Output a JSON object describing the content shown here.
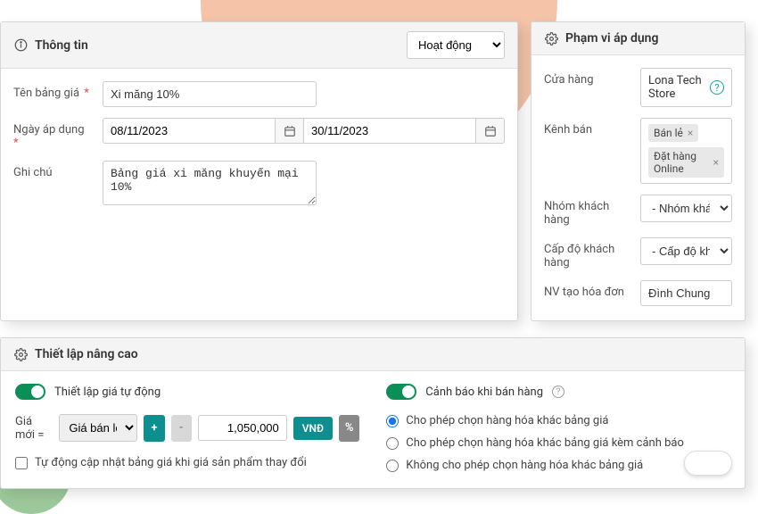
{
  "leftPanel": {
    "title": "Thông tin",
    "status_options": [
      "Hoạt động"
    ],
    "status_value": "Hoạt động",
    "fields": {
      "name_label": "Tên bảng giá",
      "name_value": "Xi măng 10%",
      "date_label": "Ngày áp dụng",
      "date_from": "08/11/2023",
      "date_to": "30/11/2023",
      "note_label": "Ghi chú",
      "note_value": "Bảng giá xi măng khuyến mại 10%"
    }
  },
  "rightPanel": {
    "title": "Phạm vi áp dụng",
    "store_label": "Cửa hàng",
    "store_value": "Lona Tech Store",
    "channel_label": "Kênh bán",
    "channel_chips": [
      "Bán lẻ",
      "Đặt hàng Online"
    ],
    "cust_group_label": "Nhóm khách hàng",
    "cust_group_placeholder": "- Nhóm khách hàng -",
    "cust_level_label": "Cấp độ khách hàng",
    "cust_level_placeholder": "- Cấp độ khách hàng -",
    "creator_label": "NV tạo hóa đơn",
    "creator_value": "Đình Chung"
  },
  "advanced": {
    "header": "Thiết lập nâng cao",
    "auto_price_label": "Thiết lập giá tự động",
    "new_price_label": "Giá mới =",
    "basis_option": "Giá bán lẻ",
    "plus": "+",
    "minus": "-",
    "amount": "1,050,000",
    "vnd": "VNĐ",
    "percent": "%",
    "auto_update_label": "Tự động cập nhật bảng giá khi giá sản phẩm thay đổi",
    "warn_label": "Cảnh báo khi bán hàng",
    "radio1": "Cho phép chọn hàng hóa khác bảng giá",
    "radio2": "Cho phép chọn hàng hóa khác bảng giá kèm cảnh báo",
    "radio3": "Không cho phép chọn hàng hóa khác bảng giá"
  }
}
